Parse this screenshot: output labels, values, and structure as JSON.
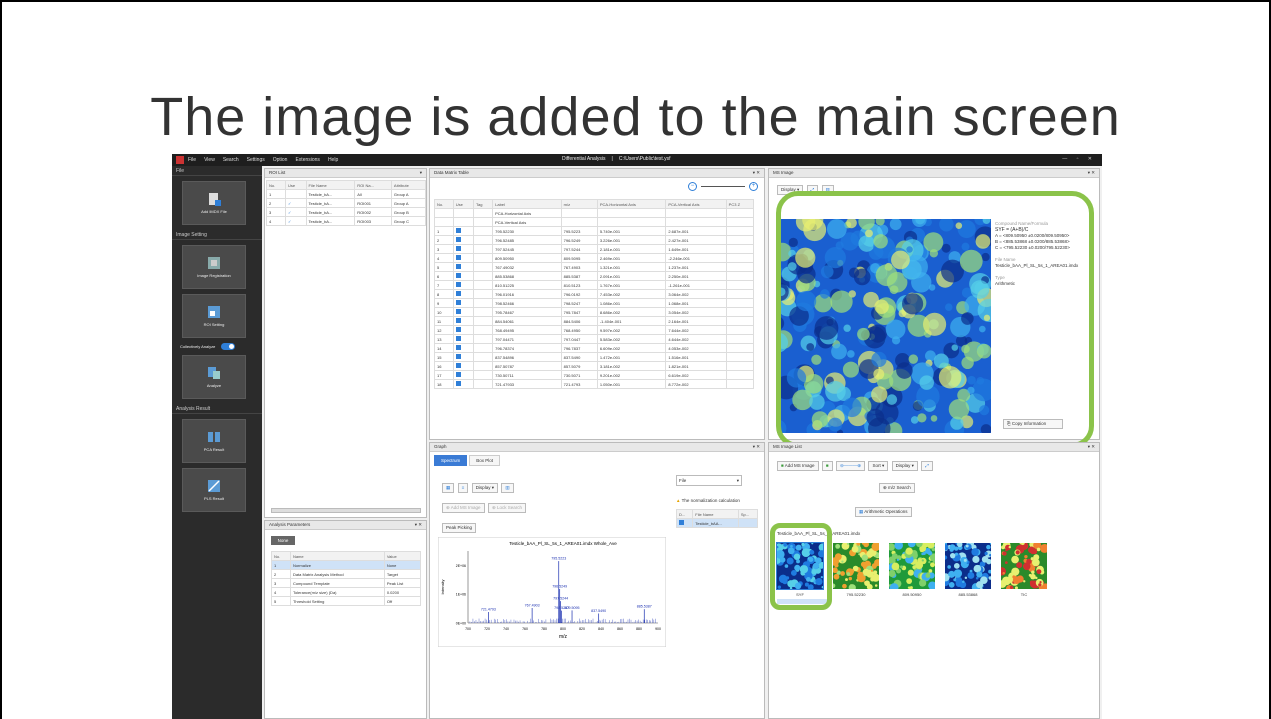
{
  "slide": {
    "title": "The image is added to the main screen"
  },
  "titlebar": {
    "menu": [
      "File",
      "View",
      "Search",
      "Settings",
      "Option",
      "Extensions",
      "Help"
    ],
    "analysis_label": "Differential Analysis",
    "path": "C:\\Users\\Public\\test.ysf"
  },
  "sidebar": {
    "file_head": "File",
    "add_file": "Add IMDX File",
    "image_setting_head": "Image Setting",
    "image_registration": "Image Registration",
    "roi_setting": "ROI Setting",
    "collectively_analyze": "Collectively Analyze",
    "analyze": "Analyze",
    "analysis_result_head": "Analysis Result",
    "pca_result": "PCA Result",
    "pls_result": "PLS Result"
  },
  "roi_list": {
    "title": "ROI List",
    "headers": [
      "No.",
      "Use",
      "File Name",
      "ROI Na...",
      "Attribute"
    ],
    "rows": [
      [
        "1",
        "",
        "Testicle_bA...",
        "All",
        "Group A"
      ],
      [
        "2",
        "✓",
        "Testicle_bA...",
        "ROI001",
        "Group A"
      ],
      [
        "3",
        "✓",
        "Testicle_bA...",
        "ROI002",
        "Group B"
      ],
      [
        "4",
        "✓",
        "Testicle_bA...",
        "ROI003",
        "Group C"
      ]
    ]
  },
  "analysis_params": {
    "title": "Analysis Parameters",
    "button": "None",
    "headers": [
      "No.",
      "Name",
      "Value"
    ],
    "rows": [
      [
        "1",
        "Normalize",
        "None"
      ],
      [
        "2",
        "Data Matrix Analysis Method",
        "Target"
      ],
      [
        "3",
        "Compound Template",
        "Peak List"
      ],
      [
        "4",
        "Tolerance(m/z size) (Da)",
        "0.0200"
      ],
      [
        "5",
        "Threshold Setting",
        "Off"
      ]
    ]
  },
  "data_matrix": {
    "title": "Data Matrix Table",
    "headers": [
      "No.",
      "Use",
      "Tag",
      "Label",
      "m/z",
      "PCA-Horizontal Axis",
      "PCA-Vertical Axis",
      "PC3 Z"
    ],
    "axis_rows": [
      "PCA-Horizontal Axis",
      "PCA-Vertical Axis"
    ],
    "rows": [
      [
        "1",
        "795.52230",
        "795.5223",
        "5.740e-001",
        "2.687e-001"
      ],
      [
        "2",
        "796.52485",
        "796.5249",
        "3.226e-001",
        "2.427e-001"
      ],
      [
        "3",
        "797.52445",
        "797.5244",
        "2.181e-001",
        "1.649e-001"
      ],
      [
        "4",
        "809.50950",
        "809.5095",
        "2.469e-001",
        "-2.246e-001"
      ],
      [
        "5",
        "767.49032",
        "767.4903",
        "1.321e-001",
        "1.237e-001"
      ],
      [
        "6",
        "885.53868",
        "885.5387",
        "2.091e-001",
        "2.250e-001"
      ],
      [
        "7",
        "810.51225",
        "810.5123",
        "1.767e-001",
        "-1.261e-001"
      ],
      [
        "8",
        "796.01916",
        "796.0192",
        "7.453e-002",
        "3.064e-002"
      ],
      [
        "9",
        "798.52466",
        "798.5247",
        "1.086e-001",
        "1.068e-001"
      ],
      [
        "10",
        "795.78467",
        "795.7847",
        "8.686e-002",
        "3.054e-002"
      ],
      [
        "11",
        "884.54061",
        "884.5406",
        "-1.404e-001",
        "2.164e-001"
      ],
      [
        "12",
        "768.49495",
        "768.4950",
        "9.597e-002",
        "7.644e-002"
      ],
      [
        "13",
        "797.04471",
        "797.0447",
        "5.583e-002",
        "4.644e-002"
      ],
      [
        "14",
        "796.78374",
        "796.7837",
        "6.609e-002",
        "4.053e-002"
      ],
      [
        "15",
        "837.54896",
        "837.5490",
        "1.472e-001",
        "1.516e-001"
      ],
      [
        "16",
        "857.50787",
        "857.5079",
        "3.181e-002",
        "1.821e-001"
      ],
      [
        "17",
        "730.50711",
        "730.5071",
        "9.201e-002",
        "6.619e-002"
      ],
      [
        "18",
        "721.47933",
        "721.4793",
        "1.050e-001",
        "8.772e-002"
      ]
    ]
  },
  "ms_image": {
    "title": "MS Image",
    "display_btn": "Display",
    "formula_head": "Compound Name/Formula",
    "formula": "SYF = (A+B)/C",
    "terms": [
      "A = <809.50950 ±0.0200/809.50950>",
      "B = <885.53868 ±0.0200/885.53868>",
      "C = <795.52230 ±0.0200/795.52230>"
    ],
    "file_name_head": "File Name",
    "file_name": "Testicle_bAA_Pl_SL_5s_1_AREA01.imdx",
    "type_head": "Type",
    "type": "Arithmetic",
    "copy_btn": "Copy Information"
  },
  "graph": {
    "title": "Graph",
    "tabs": [
      "Spectrum",
      "Box Plot"
    ],
    "display": "Display",
    "add_ms_image": "Add MS Image",
    "lock_search": "Lock Search",
    "peak_picking": "Peak Picking",
    "file_dropdown": "File",
    "warning": "The normalization calculation",
    "list_headers": [
      "D...",
      "File Name",
      "Sp..."
    ],
    "list_row": "Testicle_bAA...",
    "chart_data": {
      "type": "line",
      "title": "Testicle_bAA_Pl_SL_5s_1_AREA01.imdx Whole_Ave",
      "xlabel": "m/z",
      "ylabel": "Intensity",
      "x_ticks": [
        "700",
        "720",
        "740",
        "760",
        "780",
        "800",
        "820",
        "840",
        "860",
        "880",
        "900"
      ],
      "y_ticks": [
        "2E+06",
        "1E+06",
        "0E+00"
      ],
      "xlim": [
        700,
        900
      ],
      "ylim": [
        0,
        2500000
      ],
      "peaks": [
        {
          "x": 721.4793,
          "y": 380000,
          "label": "721.4793"
        },
        {
          "x": 767.4903,
          "y": 520000,
          "label": "767.4903"
        },
        {
          "x": 795.5223,
          "y": 2150000,
          "label": "795.5223"
        },
        {
          "x": 796.5249,
          "y": 1180000,
          "label": "796.5249"
        },
        {
          "x": 797.5244,
          "y": 760000,
          "label": "797.5244"
        },
        {
          "x": 798.5247,
          "y": 430000,
          "label": "798.5247"
        },
        {
          "x": 809.5095,
          "y": 440000,
          "label": "809.5095"
        },
        {
          "x": 837.549,
          "y": 330000,
          "label": "837.5490"
        },
        {
          "x": 885.5387,
          "y": 480000,
          "label": "885.5387"
        }
      ]
    }
  },
  "ms_image_list": {
    "title": "MS Image List",
    "add_btn": "Add MS Image",
    "sort_btn": "Sort",
    "display_btn": "Display",
    "mz_search": "m/z Search",
    "arith_btn": "Arithmetic Operations",
    "file_label": "Testicle_bAA_Pl_SL_5s_1_AREA01.imdx",
    "thumbs": [
      "SYF",
      "795.52230",
      "809.50950",
      "885.53868",
      "TIC"
    ]
  },
  "colors": {
    "accent_green": "#8bc34a",
    "accent_blue": "#2f7fd8",
    "sidebar_bg": "#2b2b2b"
  }
}
